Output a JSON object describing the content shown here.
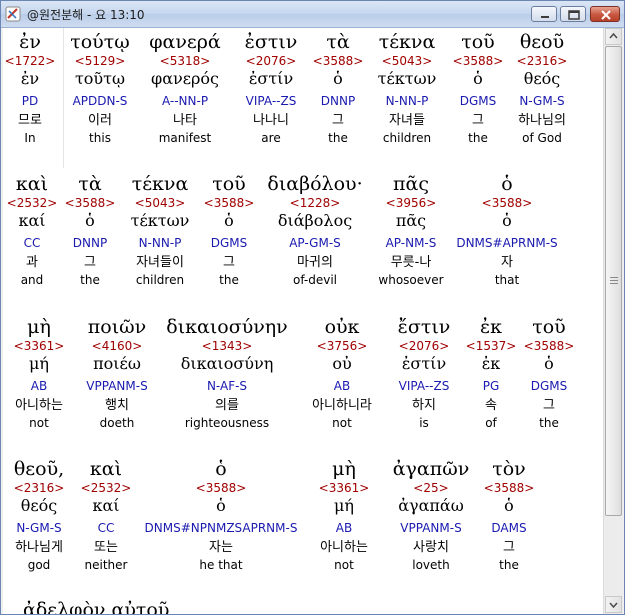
{
  "window": {
    "title": "@원전분해 - 요 13:10",
    "icon": "bible-app-icon"
  },
  "controls": {
    "minimize": "minimize-icon",
    "maximize": "maximize-icon",
    "close": "close-icon"
  },
  "rows": [
    {
      "words": [
        {
          "greek": "ἐν",
          "strong": "<1722>",
          "lemma": "ἐν",
          "parse": "PD",
          "korean": "므로",
          "english": "In"
        },
        {
          "greek": "τούτῳ",
          "strong": "<5129>",
          "lemma": "τοῦτῳ",
          "parse": "APDDN-S",
          "korean": "이러",
          "english": "this"
        },
        {
          "greek": "φανερά",
          "strong": "<5318>",
          "lemma": "φανερός",
          "parse": "A--NN-P",
          "korean": "나타",
          "english": "manifest"
        },
        {
          "greek": "ἐστιν",
          "strong": "<2076>",
          "lemma": "ἐστίν",
          "parse": "VIPA--ZS",
          "korean": "나나니",
          "english": "are"
        },
        {
          "greek": "τὰ",
          "strong": "<3588>",
          "lemma": "ὁ",
          "parse": "DNNP",
          "korean": "그",
          "english": "the"
        },
        {
          "greek": "τέκνα",
          "strong": "<5043>",
          "lemma": "τέκτων",
          "parse": "N-NN-P",
          "korean": "자녀들",
          "english": "children"
        },
        {
          "greek": "τοῦ",
          "strong": "<3588>",
          "lemma": "ὁ",
          "parse": "DGMS",
          "korean": "그",
          "english": "the"
        },
        {
          "greek": "θεοῦ",
          "strong": "<2316>",
          "lemma": "θεός",
          "parse": "N-GM-S",
          "korean": "하나님의",
          "english": "of God"
        }
      ]
    },
    {
      "words": [
        {
          "greek": "καὶ",
          "strong": "<2532>",
          "lemma": "καί",
          "parse": "CC",
          "korean": "과",
          "english": "and"
        },
        {
          "greek": "τὰ",
          "strong": "<3588>",
          "lemma": "ὁ",
          "parse": "DNNP",
          "korean": "그",
          "english": "the"
        },
        {
          "greek": "τέκνα",
          "strong": "<5043>",
          "lemma": "τέκτων",
          "parse": "N-NN-P",
          "korean": "자녀들이",
          "english": "children"
        },
        {
          "greek": "τοῦ",
          "strong": "<3588>",
          "lemma": "ὁ",
          "parse": "DGMS",
          "korean": "그",
          "english": "the"
        },
        {
          "greek": "διαβόλου·",
          "strong": "<1228>",
          "lemma": "διάβολος",
          "parse": "AP-GM-S",
          "korean": "마귀의",
          "english": "of-devil"
        },
        {
          "greek": "πᾶς",
          "strong": "<3956>",
          "lemma": "πᾶς",
          "parse": "AP-NM-S",
          "korean": "무릇-나",
          "english": "whosoever"
        },
        {
          "greek": "ὁ",
          "strong": "<3588>",
          "lemma": "ὁ",
          "parse": "DNMS#APRNM-S",
          "korean": "자",
          "english": "that"
        }
      ]
    },
    {
      "words": [
        {
          "greek": "μὴ",
          "strong": "<3361>",
          "lemma": "μή",
          "parse": "AB",
          "korean": "아니하는",
          "english": "not"
        },
        {
          "greek": "ποιῶν",
          "strong": "<4160>",
          "lemma": "ποιέω",
          "parse": "VPPANM-S",
          "korean": "행치",
          "english": "doeth"
        },
        {
          "greek": "δικαιοσύνην",
          "strong": "<1343>",
          "lemma": "δικαιοσύνη",
          "parse": "N-AF-S",
          "korean": "의를",
          "english": "righteousness"
        },
        {
          "greek": "οὐκ",
          "strong": "<3756>",
          "lemma": "οὐ",
          "parse": "AB",
          "korean": "아니하니라",
          "english": "not"
        },
        {
          "greek": "ἔστιν",
          "strong": "<2076>",
          "lemma": "ἐστίν",
          "parse": "VIPA--ZS",
          "korean": "하지",
          "english": "is"
        },
        {
          "greek": "ἐκ",
          "strong": "<1537>",
          "lemma": "ἐκ",
          "parse": "PG",
          "korean": "속",
          "english": "of"
        },
        {
          "greek": "τοῦ",
          "strong": "<3588>",
          "lemma": "ὁ",
          "parse": "DGMS",
          "korean": "그",
          "english": "the"
        }
      ]
    },
    {
      "words": [
        {
          "greek": "θεοῦ,",
          "strong": "<2316>",
          "lemma": "θεός",
          "parse": "N-GM-S",
          "korean": "하나님게",
          "english": "god"
        },
        {
          "greek": "καὶ",
          "strong": "<2532>",
          "lemma": "καί",
          "parse": "CC",
          "korean": "또는",
          "english": "neither"
        },
        {
          "greek": "ὁ",
          "strong": "<3588>",
          "lemma": "ὁ",
          "parse": "DNMS#NPNMZSAPRNM-S",
          "korean": "자는",
          "english": "he that"
        },
        {
          "greek": "μὴ",
          "strong": "<3361>",
          "lemma": "μή",
          "parse": "AB",
          "korean": "아니하는",
          "english": "not"
        },
        {
          "greek": "ἀγαπῶν",
          "strong": "<25>",
          "lemma": "ἀγαπάω",
          "parse": "VPPANM-S",
          "korean": "사랑치",
          "english": "loveth"
        },
        {
          "greek": "τὸν",
          "strong": "<3588>",
          "lemma": "ὁ",
          "parse": "DAMS",
          "korean": "그",
          "english": "the"
        }
      ]
    }
  ],
  "partial_line": "ἀδελφὸν αὐτοῦ",
  "colors": {
    "greek": "#000000",
    "strong": "#a00000",
    "parse": "#1a1ab0",
    "korean": "#000000",
    "english": "#000000"
  }
}
